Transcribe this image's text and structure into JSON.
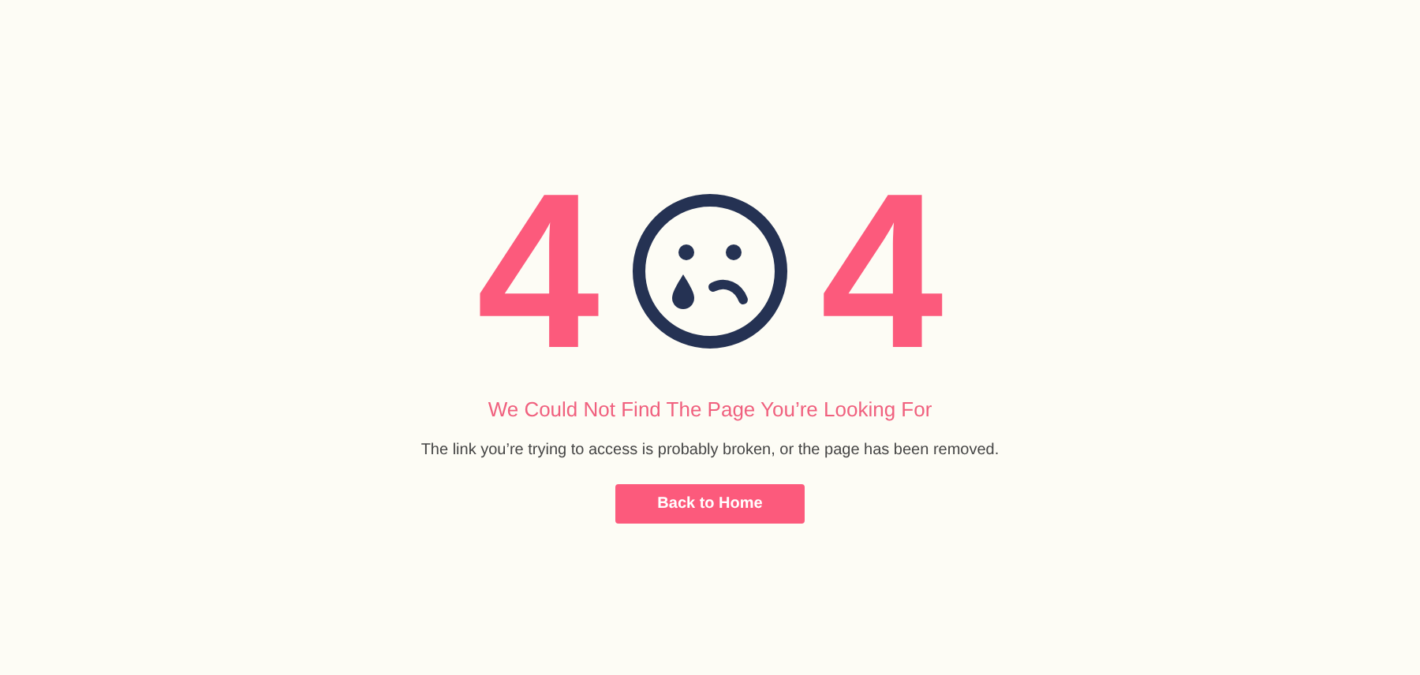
{
  "code": {
    "first": "4",
    "last": "4"
  },
  "heading": "We Could Not Find The Page You’re Looking For",
  "message": "The link you’re trying to access is probably broken, or the page has been removed.",
  "button": "Back to Home"
}
